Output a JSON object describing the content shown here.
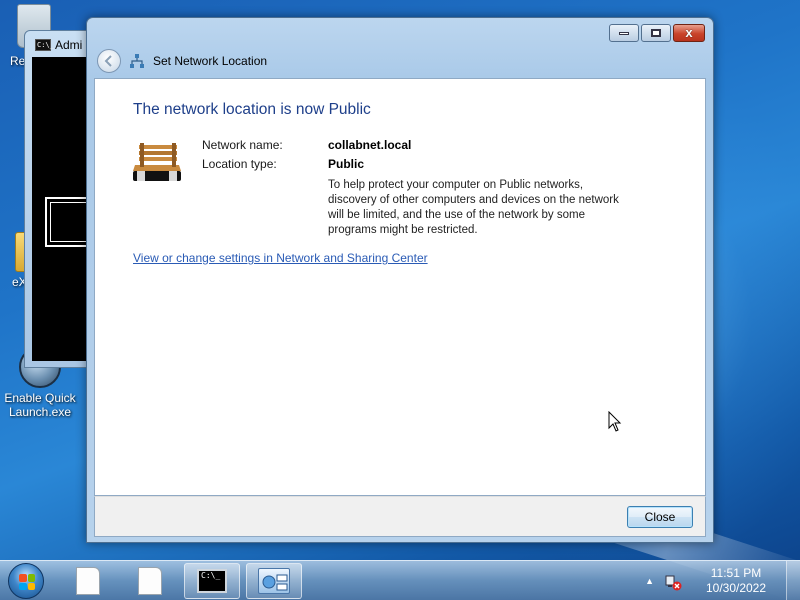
{
  "desktop": {
    "icons": [
      {
        "label": "Re"
      },
      {
        "label": "eX"
      },
      {
        "label": "Enable Quick Launch.exe"
      }
    ]
  },
  "console": {
    "title": "Admi",
    "icon_text": "C:\\_"
  },
  "dialog": {
    "nav_title": "Set Network Location",
    "heading": "The network location is now Public",
    "network_name_label": "Network name:",
    "network_name_value": "collabnet.local",
    "location_type_label": "Location type:",
    "location_type_value": "Public",
    "description": "To help protect your computer on Public networks, discovery of other computers and devices on the network will be limited, and the use of the network by some programs might be restricted.",
    "link": "View or change settings in Network and Sharing Center",
    "close_button": "Close",
    "caption": {
      "close_glyph": "x"
    }
  },
  "taskbar": {
    "cmd_text": "C:\\_",
    "clock": {
      "time": "11:51 PM",
      "date": "10/30/2022"
    },
    "tray_arrow": "▲"
  },
  "colors": {
    "heading": "#1e3f8a",
    "link": "#2a5bb5",
    "close_red": "#c9432a"
  }
}
